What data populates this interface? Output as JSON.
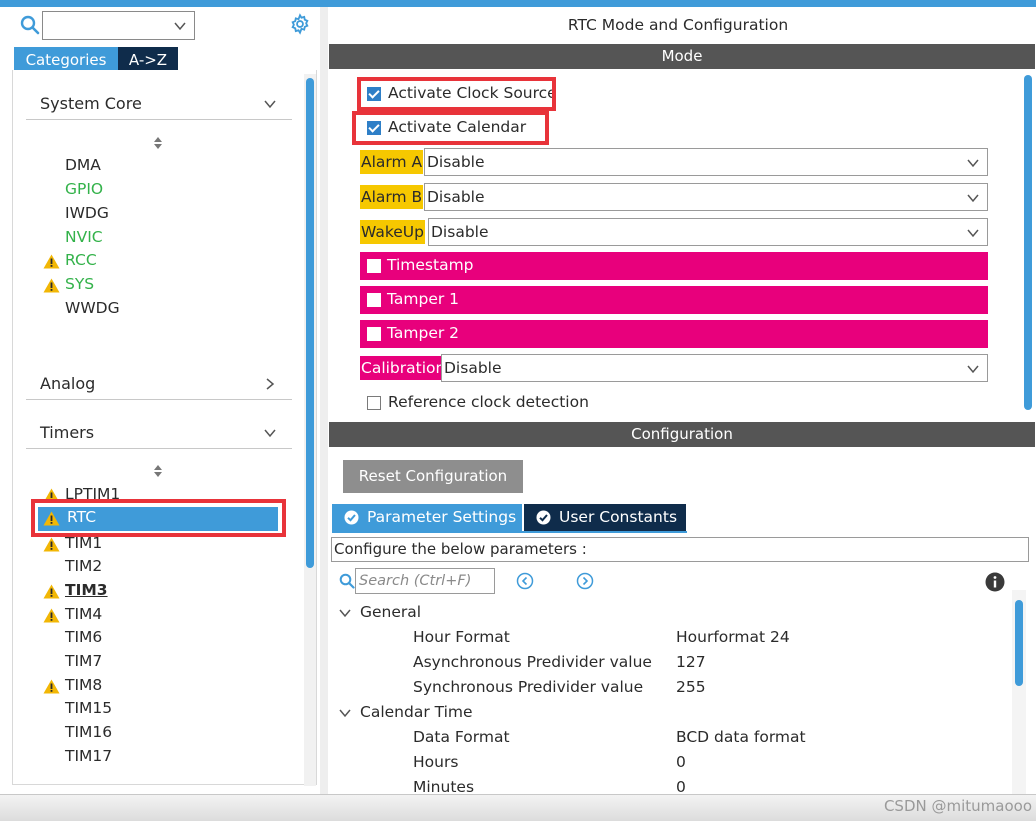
{
  "left": {
    "search_value": "",
    "tabs": {
      "categories": "Categories",
      "az": "A->Z"
    },
    "groups": {
      "system_core": "System Core",
      "analog": "Analog",
      "timers": "Timers"
    },
    "system_core_items": [
      "DMA",
      "GPIO",
      "IWDG",
      "NVIC",
      "RCC",
      "SYS",
      "WWDG"
    ],
    "timers_items": [
      "LPTIM1",
      "RTC",
      "TIM1",
      "TIM2",
      "TIM3",
      "TIM4",
      "TIM6",
      "TIM7",
      "TIM8",
      "TIM15",
      "TIM16",
      "TIM17"
    ]
  },
  "right": {
    "title": "RTC Mode and Configuration",
    "mode_bar": "Mode",
    "activate_clock_source": "Activate Clock Source",
    "activate_calendar": "Activate Calendar",
    "alarm_a_label": "Alarm A",
    "alarm_a_value": "Disable",
    "alarm_b_label": "Alarm B",
    "alarm_b_value": "Disable",
    "wakeup_label": "WakeUp",
    "wakeup_value": "Disable",
    "timestamp": "Timestamp",
    "tamper1": "Tamper 1",
    "tamper2": "Tamper 2",
    "calibration_label": "Calibration",
    "calibration_value": "Disable",
    "reference_clock": "Reference clock detection",
    "config_bar": "Configuration",
    "reset_button": "Reset Configuration",
    "tab_parameters": "Parameter Settings",
    "tab_user_constants": "User Constants",
    "description": "Configure the below parameters :",
    "search_placeholder": "Search (Ctrl+F)",
    "general_group": "General",
    "general_params": [
      {
        "name": "Hour Format",
        "value": "Hourformat 24"
      },
      {
        "name": "Asynchronous Predivider value",
        "value": "127"
      },
      {
        "name": "Synchronous Predivider value",
        "value": "255"
      }
    ],
    "calendar_group": "Calendar Time",
    "calendar_params": [
      {
        "name": "Data Format",
        "value": "BCD data format"
      },
      {
        "name": "Hours",
        "value": "0"
      },
      {
        "name": "Minutes",
        "value": "0"
      }
    ]
  },
  "watermark": "CSDN @mitumaooo",
  "colors": {
    "accent_blue": "#3f9bd9",
    "dark_navy": "#0f2c4b",
    "highlight_yellow": "#f6c800",
    "highlight_pink": "#e8007c",
    "annotation_red": "#e8333a",
    "warning_yellow": "#f2b705",
    "gpio_green": "#33b24a"
  }
}
